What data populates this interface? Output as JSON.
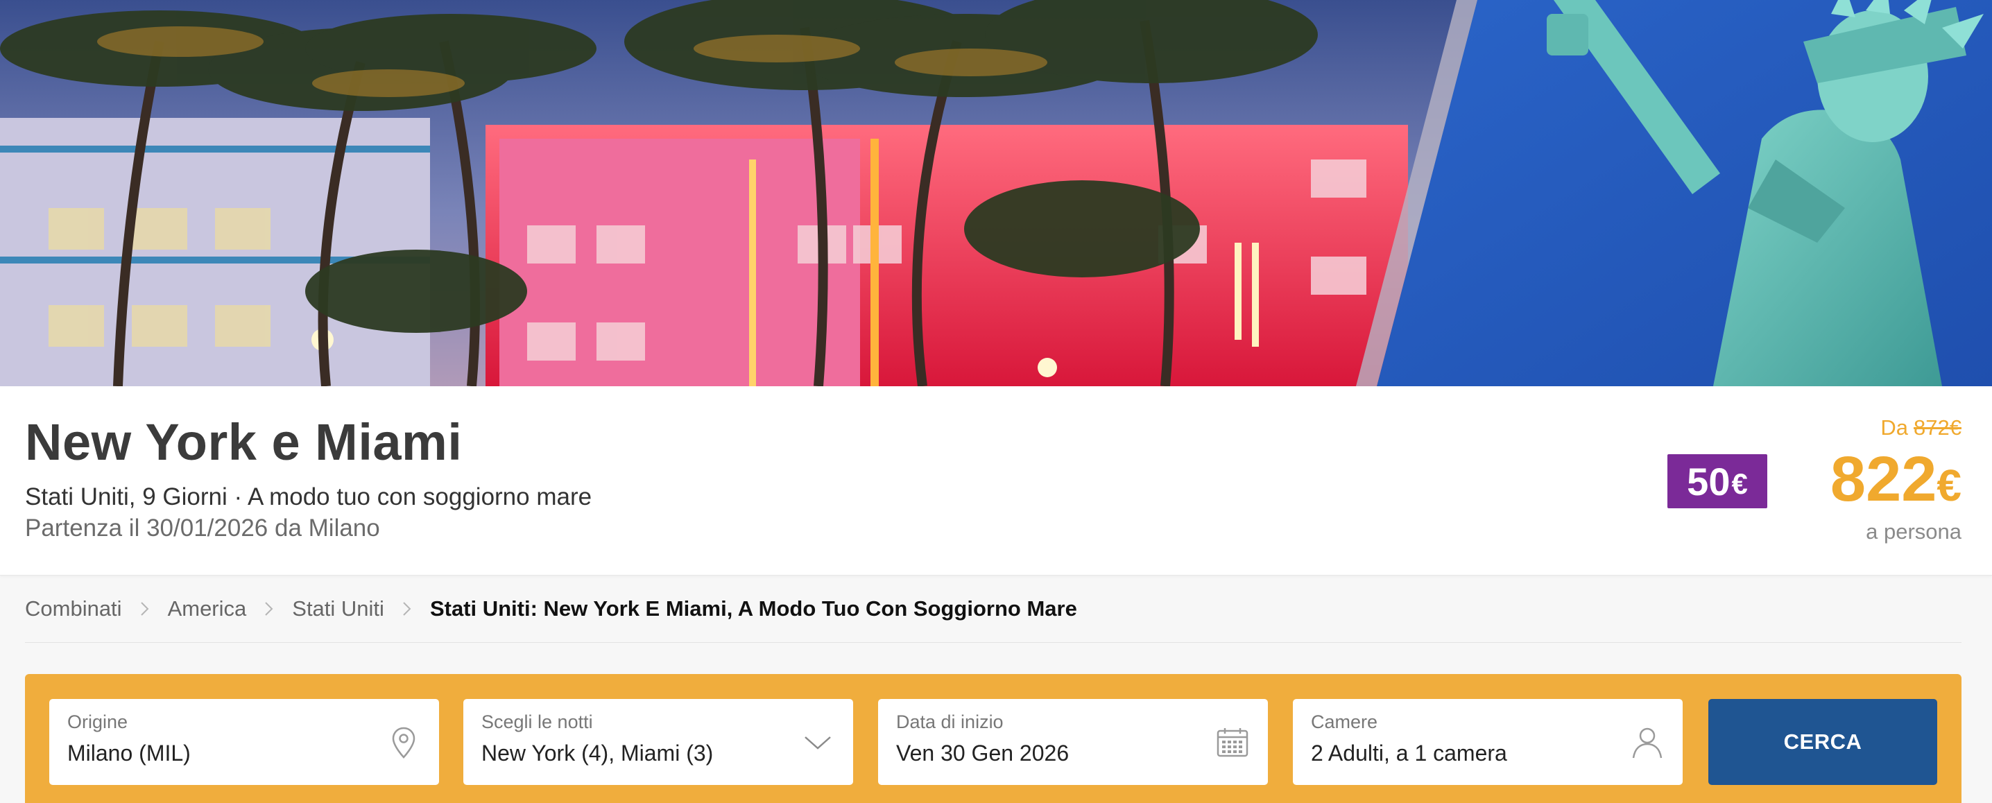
{
  "hero": {
    "image_description_icon": "hero-photo"
  },
  "trip": {
    "title": "New York e Miami",
    "subtitle": "Stati Uniti, 9 Giorni · A modo tuo con soggiorno mare",
    "departure": "Partenza il 30/01/2026 da Milano"
  },
  "pricing": {
    "discount_value": "50",
    "discount_currency": "€",
    "from_label": "Da",
    "old_price": "872€",
    "price_value": "822",
    "price_currency": "€",
    "per_person": "a persona",
    "accent_color": "#f0a92e",
    "badge_color": "#7b2a98"
  },
  "breadcrumb": {
    "items": [
      "Combinati",
      "America",
      "Stati Uniti"
    ],
    "current": "Stati Uniti: New York E Miami, A Modo Tuo Con Soggiorno Mare"
  },
  "search": {
    "bar_color": "#f0ad3d",
    "button_color": "#1f5592",
    "origin": {
      "label": "Origine",
      "value": "Milano (MIL)",
      "icon": "location-pin-icon"
    },
    "nights": {
      "label": "Scegli le notti",
      "value": "New York (4), Miami (3)",
      "icon": "chevron-down-icon"
    },
    "start_date": {
      "label": "Data di inizio",
      "value": "Ven 30 Gen 2026",
      "icon": "calendar-icon"
    },
    "rooms": {
      "label": "Camere",
      "value": "2 Adulti, a 1 camera",
      "icon": "user-icon"
    },
    "button_label": "CERCA"
  }
}
